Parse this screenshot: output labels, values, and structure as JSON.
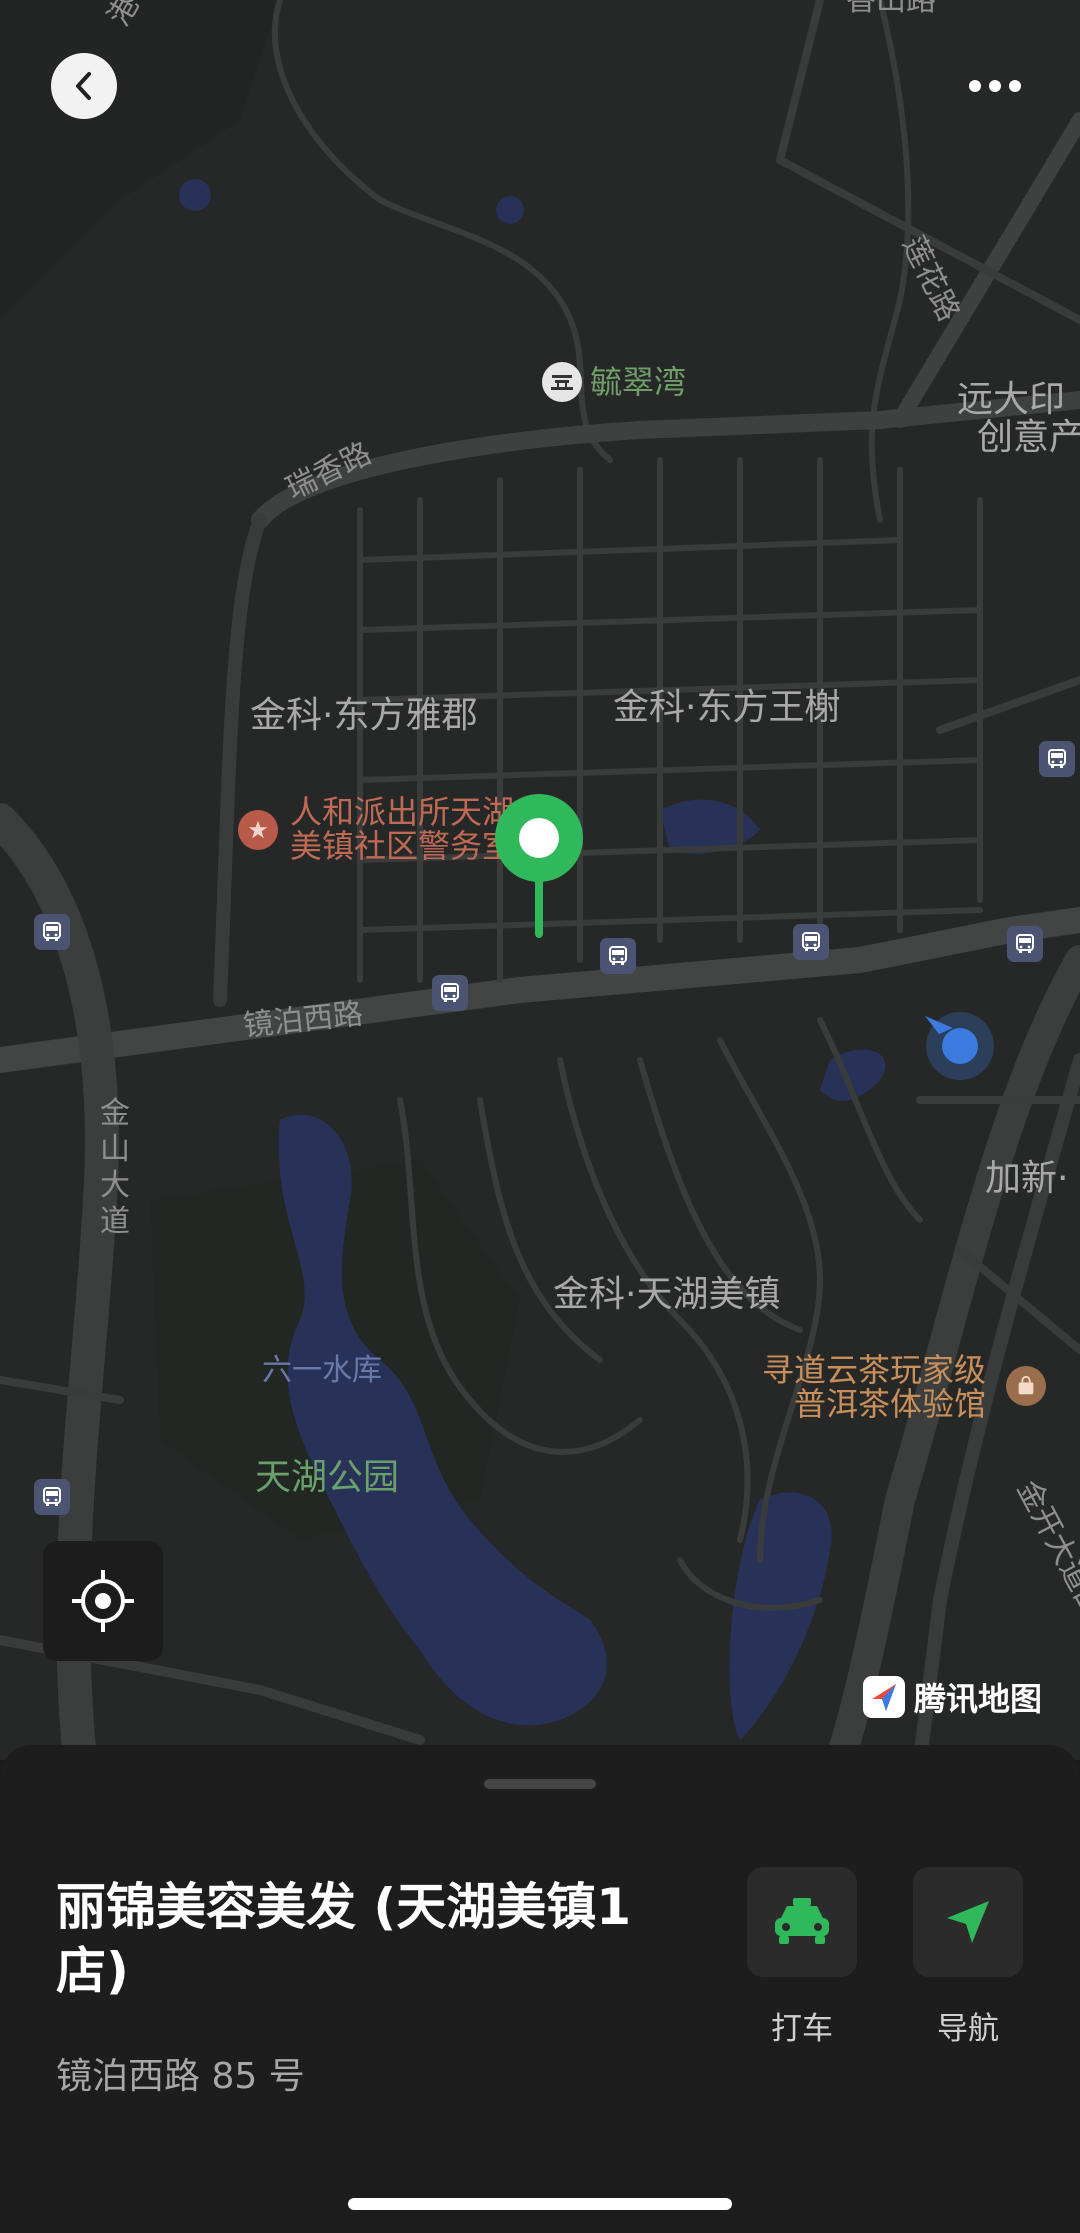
{
  "map": {
    "provider": "腾讯地图",
    "areas": {
      "fangyajun": "金科·东方雅郡",
      "wangxie": "金科·东方王榭",
      "tianhu": "金科·天湖美镇",
      "yuancuiwan": "毓翠湾",
      "yuanda_l1": "远大印",
      "yuanda_l2": "创意产",
      "jiaxin": "加新·"
    },
    "roads": {
      "ruixiang": "瑞香路",
      "jingbo": "镜泊西路",
      "lianhua": "莲花路",
      "jinshan": "金山大道",
      "jinkai": "金开大道西段",
      "top_left": "港",
      "top_center": "香山路"
    },
    "water": {
      "liuyi": "六一水库"
    },
    "park": {
      "tianhu_park": "天湖公园"
    },
    "pois": {
      "police_l1": "人和派出所天湖",
      "police_l2": "美镇社区警务室",
      "tea_l1": "寻道云茶玩家级",
      "tea_l2": "普洱茶体验馆"
    },
    "colors": {
      "background": "#262827",
      "road": "#3a3c3c",
      "water": "#283258",
      "pin": "#2fb95a",
      "user": "#3b7be0"
    }
  },
  "place": {
    "name": "丽锦美容美发 (天湖美镇1店)",
    "address": "镜泊西路 85 号"
  },
  "actions": {
    "taxi": "打车",
    "navigate": "导航"
  }
}
